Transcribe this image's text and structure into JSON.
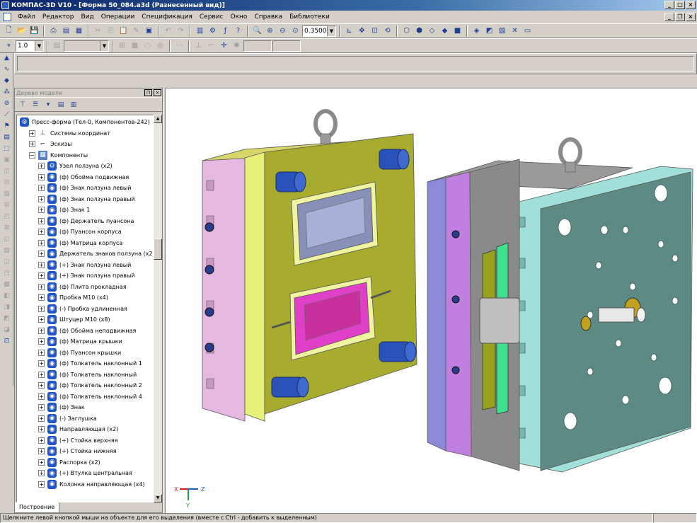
{
  "window": {
    "title": "КОМПАС-3D V10 - [Форма 50_084.a3d (Разнесенный вид)]",
    "min": "_",
    "max": "□",
    "close": "×",
    "doc_min": "_",
    "doc_restore": "❐",
    "doc_close": "×"
  },
  "menu": [
    "Файл",
    "Редактор",
    "Вид",
    "Операции",
    "Спецификация",
    "Сервис",
    "Окно",
    "Справка",
    "Библиотеки"
  ],
  "toolbar": {
    "zoom_value": "0.3500",
    "step_value": "1.0"
  },
  "tree": {
    "header": "Дерево модели",
    "tab": "Построение",
    "items": [
      {
        "level": 0,
        "exp": "",
        "icon": "assembly",
        "label": "Пресс-форма (Тел-0, Компонентов-242)"
      },
      {
        "level": 1,
        "exp": "+",
        "icon": "coords",
        "label": "Системы координат"
      },
      {
        "level": 1,
        "exp": "+",
        "icon": "sketch",
        "label": "Эскизы"
      },
      {
        "level": 1,
        "exp": "−",
        "icon": "components",
        "label": "Компоненты"
      },
      {
        "level": 2,
        "exp": "+",
        "icon": "subassembly",
        "label": "Узел ползуна (x2)"
      },
      {
        "level": 2,
        "exp": "+",
        "icon": "part",
        "label": "(ф) Обойма подвижная"
      },
      {
        "level": 2,
        "exp": "+",
        "icon": "part",
        "label": "(ф) Знак ползуна левый"
      },
      {
        "level": 2,
        "exp": "+",
        "icon": "part",
        "label": "(ф) Знак ползуна правый"
      },
      {
        "level": 2,
        "exp": "+",
        "icon": "part",
        "label": "(ф) Знак 1"
      },
      {
        "level": 2,
        "exp": "+",
        "icon": "part",
        "label": "(ф) Держатель пуансона"
      },
      {
        "level": 2,
        "exp": "+",
        "icon": "part",
        "label": "(ф) Пуансон корпуса"
      },
      {
        "level": 2,
        "exp": "+",
        "icon": "part",
        "label": "(ф) Матрица корпуса"
      },
      {
        "level": 2,
        "exp": "+",
        "icon": "part",
        "label": "Держатель знаков ползуна (x2)"
      },
      {
        "level": 2,
        "exp": "+",
        "icon": "part",
        "label": "(+) Знак ползуна левый"
      },
      {
        "level": 2,
        "exp": "+",
        "icon": "part",
        "label": "(+) Знак ползуна правый"
      },
      {
        "level": 2,
        "exp": "+",
        "icon": "part",
        "label": "(ф) Плита прокладная"
      },
      {
        "level": 2,
        "exp": "+",
        "icon": "part",
        "label": "Пробка М10 (x4)"
      },
      {
        "level": 2,
        "exp": "+",
        "icon": "part",
        "label": "(-) Пробка удлиненная"
      },
      {
        "level": 2,
        "exp": "+",
        "icon": "part",
        "label": "Штуцер М10 (x8)"
      },
      {
        "level": 2,
        "exp": "+",
        "icon": "part",
        "label": "(ф) Обойма неподвижная"
      },
      {
        "level": 2,
        "exp": "+",
        "icon": "part",
        "label": "(ф) Матрица крышки"
      },
      {
        "level": 2,
        "exp": "+",
        "icon": "part",
        "label": "(ф) Пуансон крышки"
      },
      {
        "level": 2,
        "exp": "+",
        "icon": "part",
        "label": "(ф) Толкатель наклонный 1"
      },
      {
        "level": 2,
        "exp": "+",
        "icon": "part",
        "label": "(ф) Толкатель наклонный"
      },
      {
        "level": 2,
        "exp": "+",
        "icon": "part",
        "label": "(ф) Толкатель наклонный 2"
      },
      {
        "level": 2,
        "exp": "+",
        "icon": "part",
        "label": "(ф) Толкатель наклонный 4"
      },
      {
        "level": 2,
        "exp": "+",
        "icon": "part",
        "label": "(ф) Знак"
      },
      {
        "level": 2,
        "exp": "+",
        "icon": "part",
        "label": "(-) Заглушка"
      },
      {
        "level": 2,
        "exp": "+",
        "icon": "part",
        "label": "Направляющая (x2)"
      },
      {
        "level": 2,
        "exp": "+",
        "icon": "part",
        "label": "(+) Стойка верхняя"
      },
      {
        "level": 2,
        "exp": "+",
        "icon": "part",
        "label": "(+) Стойка нижняя"
      },
      {
        "level": 2,
        "exp": "+",
        "icon": "part",
        "label": "Распорка (x2)"
      },
      {
        "level": 2,
        "exp": "+",
        "icon": "part",
        "label": "(+) Втулка центральная"
      },
      {
        "level": 2,
        "exp": "+",
        "icon": "part",
        "label": "Колонка направляющая (x4)"
      }
    ]
  },
  "axes": {
    "x": "X",
    "y": "Y",
    "z": "Z"
  },
  "status": {
    "text": "Щелкните левой кнопкой мыши на объекте для его выделения (вместе с Ctrl - добавить к выделенным)"
  }
}
